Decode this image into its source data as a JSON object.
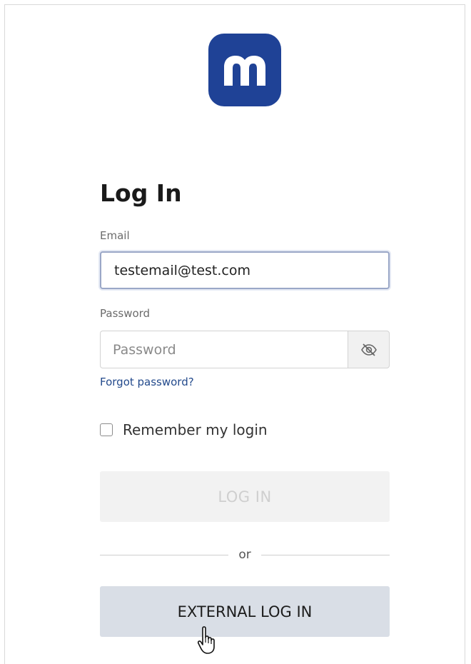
{
  "login": {
    "title": "Log In",
    "email": {
      "label": "Email",
      "value": "testemail@test.com"
    },
    "password": {
      "label": "Password",
      "placeholder": "Password",
      "toggle_icon": "eye-slash-icon"
    },
    "forgot_password": "Forgot password?",
    "remember": {
      "label": "Remember my login",
      "checked": false
    },
    "login_button": "LOG IN",
    "divider_text": "or",
    "external_login_button": "EXTERNAL LOG IN"
  },
  "brand": {
    "logo_icon": "m-logo-icon",
    "color": "#1f4296"
  },
  "cursor": "hand-pointer-icon"
}
